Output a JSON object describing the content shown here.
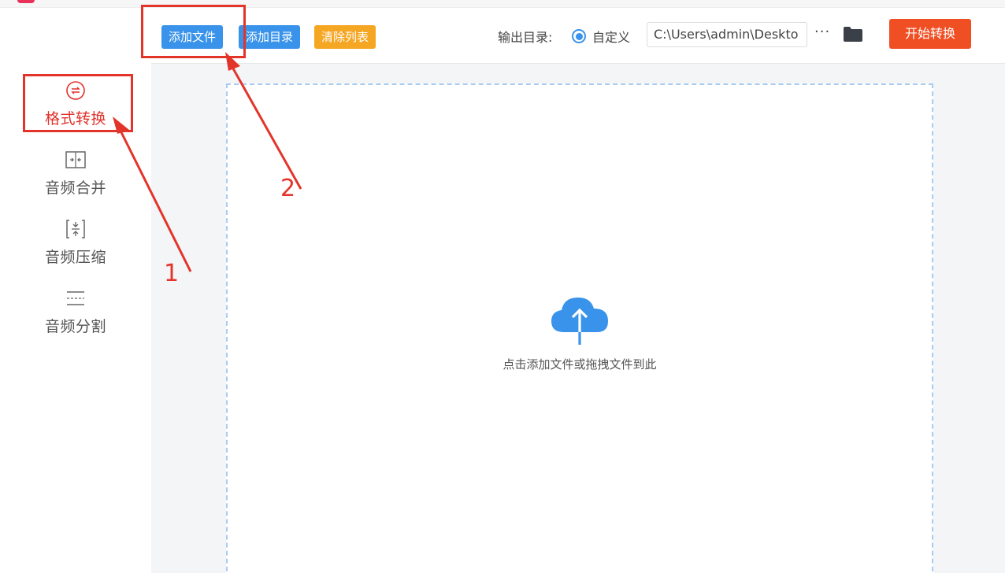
{
  "sidebar": {
    "items": [
      {
        "label": "格式转换",
        "icon": "format-convert-icon",
        "active": true
      },
      {
        "label": "音频合并",
        "icon": "audio-merge-icon",
        "active": false
      },
      {
        "label": "音频压缩",
        "icon": "audio-compress-icon",
        "active": false
      },
      {
        "label": "音频分割",
        "icon": "audio-split-icon",
        "active": false
      }
    ]
  },
  "toolbar": {
    "add_file_label": "添加文件",
    "add_folder_label": "添加目录",
    "clear_list_label": "清除列表",
    "output_dir_label": "输出目录:",
    "custom_option_label": "自定义",
    "output_path_value": "C:\\Users\\admin\\Deskto",
    "more_label": "···",
    "start_label": "开始转换"
  },
  "drop_zone": {
    "hint": "点击添加文件或拖拽文件到此"
  },
  "annotations": {
    "step1": "1",
    "step2": "2"
  },
  "colors": {
    "accent_blue": "#3a93ea",
    "accent_orange": "#f5a623",
    "start_red": "#f04e23",
    "annotation_red": "#e3342a"
  }
}
